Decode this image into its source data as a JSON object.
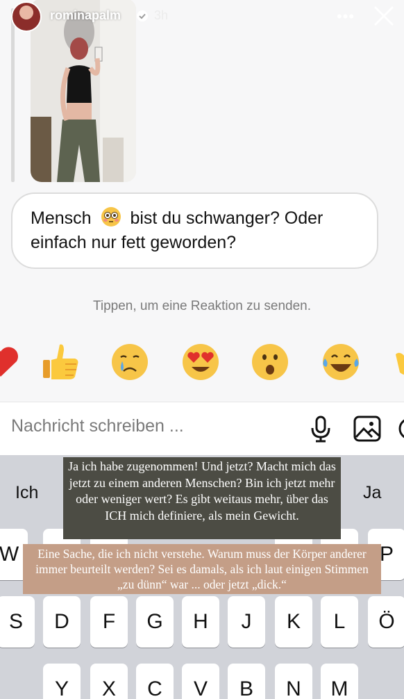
{
  "header": {
    "username": "rominapalm",
    "time": "3h",
    "more_label": "•••"
  },
  "message": {
    "text_before_emoji": "Mensch",
    "text_after_emoji": "bist du schwanger? Oder einfach nur fett geworden?",
    "emoji": "flushed-face"
  },
  "reaction_hint": "Tippen, um eine Reaktion zu senden.",
  "reactions": [
    "heart",
    "thumbs-up",
    "crying-face",
    "heart-eyes",
    "surprised-face",
    "tears-of-joy",
    "clapping-hands"
  ],
  "composer": {
    "placeholder": "Nachricht schreiben ..."
  },
  "keyboard": {
    "suggestions": [
      "Ich",
      "Ja"
    ],
    "row2_visible": [
      "W",
      "P"
    ],
    "row3": [
      "S",
      "D",
      "F",
      "G",
      "H",
      "J",
      "K",
      "L",
      "Ö"
    ],
    "row4": [
      "Y",
      "X",
      "C",
      "V",
      "B",
      "N",
      "M"
    ]
  },
  "captions": {
    "first": "Ja ich habe zugenommen! Und jetzt? Macht mich das jetzt zu einem anderen Menschen? Bin ich jetzt mehr oder weniger wert? Es gibt weitaus mehr, über das ICH mich definiere, als mein Gewicht.",
    "second": "Eine Sache, die ich nicht verstehe. Warum muss der Körper anderer immer beurteilt werden? Sei es damals, als ich laut einigen Stimmen „zu dünn“ war ... oder jetzt „dick.“"
  },
  "colors": {
    "caption_dark_bg": "#4c4c44",
    "caption_tan_bg": "#c49e87",
    "keyboard_bg": "#d1d3d9"
  }
}
